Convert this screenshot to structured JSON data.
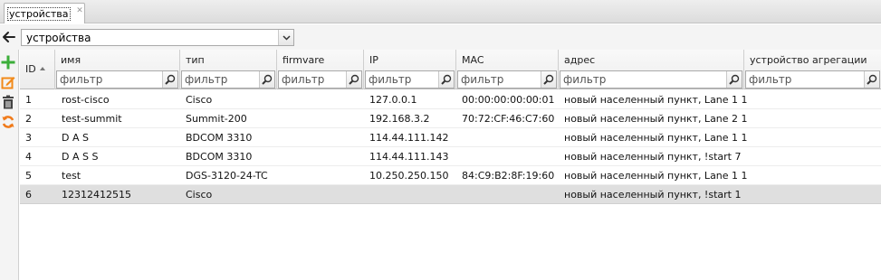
{
  "tab": {
    "label": "устройства",
    "close_glyph": "✕"
  },
  "navigation": {
    "back_icon": "arrow-left-icon",
    "device_select": {
      "value": "устройства",
      "trigger_icon": "chevron-down-icon"
    }
  },
  "toolbar": {
    "buttons": [
      {
        "name": "add",
        "icon": "plus-icon",
        "color": "#3cae3a"
      },
      {
        "name": "edit",
        "icon": "pencil-edit-icon",
        "color": "#f28a1a"
      },
      {
        "name": "delete",
        "icon": "trash-icon",
        "color": "#444444"
      },
      {
        "name": "refresh",
        "icon": "refresh-icon",
        "color": "#f07a1a"
      }
    ]
  },
  "grid": {
    "filter_placeholder": "фильтр",
    "filter_icon": "search-icon",
    "columns": [
      {
        "key": "id",
        "title": "ID",
        "sortable": true,
        "sort": "asc"
      },
      {
        "key": "name",
        "title": "имя"
      },
      {
        "key": "type",
        "title": "тип"
      },
      {
        "key": "firmware",
        "title": "firmvare"
      },
      {
        "key": "ip",
        "title": "IP"
      },
      {
        "key": "mac",
        "title": "MAC"
      },
      {
        "key": "address",
        "title": "адрес"
      },
      {
        "key": "aggregation",
        "title": "устройство агрегации"
      }
    ],
    "rows": [
      {
        "id": "1",
        "name": "rost-cisco",
        "type": "Cisco",
        "firmware": "",
        "ip": "127.0.0.1",
        "mac": "00:00:00:00:00:01",
        "address": "новый населенный пункт, Lane 1 1",
        "aggregation": ""
      },
      {
        "id": "2",
        "name": "test-summit",
        "type": "Summit-200",
        "firmware": "",
        "ip": "192.168.3.2",
        "mac": "70:72:CF:46:C7:60",
        "address": "новый населенный пункт, Lane 2 1",
        "aggregation": ""
      },
      {
        "id": "3",
        "name": "D A S",
        "type": "BDCOM 3310",
        "firmware": "",
        "ip": "114.44.111.142",
        "mac": "",
        "address": "новый населенный пункт, Lane 1 1",
        "aggregation": ""
      },
      {
        "id": "4",
        "name": "D A S S",
        "type": "BDCOM 3310",
        "firmware": "",
        "ip": "114.44.111.143",
        "mac": "",
        "address": "новый населенный пункт, !start 7",
        "aggregation": ""
      },
      {
        "id": "5",
        "name": "test",
        "type": "DGS-3120-24-TC",
        "firmware": "",
        "ip": "10.250.250.150",
        "mac": "84:C9:B2:8F:19:60",
        "address": "новый населенный пункт, Lane 1 1",
        "aggregation": ""
      },
      {
        "id": "6",
        "name": "12312412515",
        "type": "Cisco",
        "firmware": "",
        "ip": "",
        "mac": "",
        "address": "новый населенный пункт, !start 1",
        "aggregation": "",
        "selected": true
      }
    ]
  }
}
